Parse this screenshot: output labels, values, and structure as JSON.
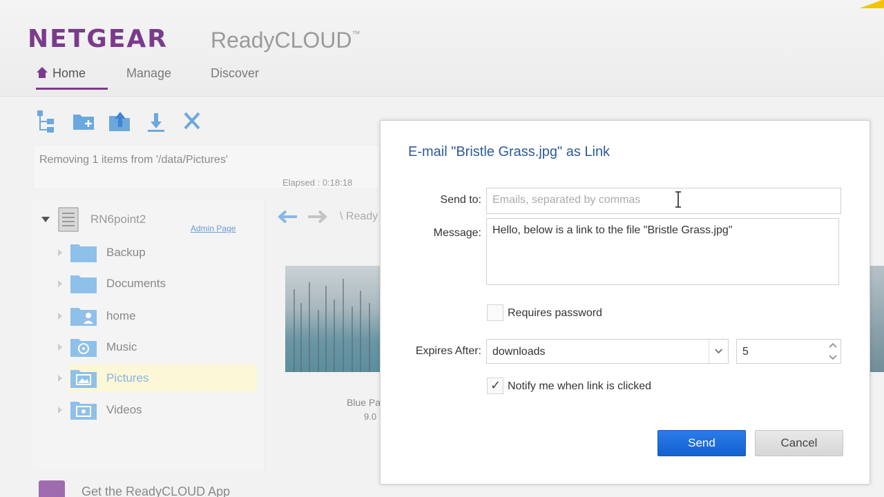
{
  "header": {
    "brand": "NETGEAR",
    "product": "ReadyCLOUD",
    "trademark": "™",
    "nav": [
      {
        "label": "Home",
        "active": true
      },
      {
        "label": "Manage",
        "active": false
      },
      {
        "label": "Discover",
        "active": false
      }
    ]
  },
  "toolbar": {
    "buttons": [
      "tree-icon",
      "new-folder-icon",
      "upload-icon",
      "download-icon",
      "delete-icon"
    ]
  },
  "status": {
    "message": "Removing 1 items from '/data/Pictures'",
    "elapsed": "Elapsed : 0:18:18"
  },
  "tree": {
    "root_label": "RN6point2",
    "admin_link": "Admin Page",
    "items": [
      {
        "label": "Backup",
        "icon": "folder-icon"
      },
      {
        "label": "Documents",
        "icon": "folder-icon"
      },
      {
        "label": "home",
        "icon": "user-folder-icon"
      },
      {
        "label": "Music",
        "icon": "music-folder-icon"
      },
      {
        "label": "Pictures",
        "icon": "pictures-folder-icon",
        "selected": true
      },
      {
        "label": "Videos",
        "icon": "videos-folder-icon"
      }
    ],
    "get_app": "Get the ReadyCLOUD App"
  },
  "content": {
    "breadcrumb": "\\ Ready",
    "thumb_name": "Blue Pa",
    "thumb_size": "9.0"
  },
  "dialog": {
    "title": "E-mail \"Bristle Grass.jpg\" as Link",
    "send_to_label": "Send to:",
    "send_to_placeholder": "Emails, separated by commas",
    "message_label": "Message:",
    "message_value": "Hello, below is a link to the file \"Bristle Grass.jpg\"",
    "requires_password": {
      "label": "Requires password",
      "checked": false
    },
    "expires_label": "Expires After:",
    "expires_select": "downloads",
    "expires_count": "5",
    "notify": {
      "label": "Notify me when link is clicked",
      "checked": true
    },
    "send_button": "Send",
    "cancel_button": "Cancel"
  },
  "colors": {
    "brand_purple": "#7b3b8c",
    "accent_blue": "#1e6fdd",
    "title_blue": "#2c5a9a",
    "selection_yellow": "#fbf7d7"
  }
}
